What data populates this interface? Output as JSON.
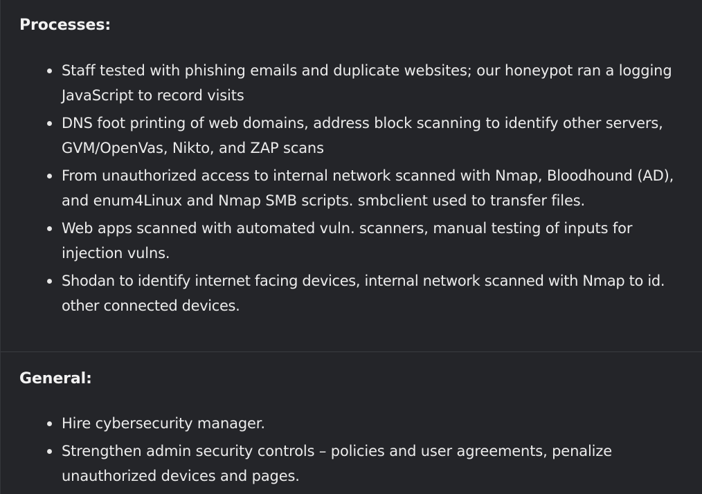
{
  "processes": {
    "heading": "Processes:",
    "items": [
      "Staff tested with phishing emails and duplicate websites; our honeypot ran a logging JavaScript to record visits",
      "DNS foot printing of web domains, address block scanning to identify other servers, GVM/OpenVas, Nikto, and ZAP scans",
      "From unauthorized access to internal network scanned with Nmap, Bloodhound (AD), and enum4Linux and Nmap SMB scripts. smbclient used to transfer files.",
      "Web apps scanned with automated vuln. scanners, manual testing of inputs for injection vulns.",
      "Shodan to identify internet facing devices, internal network scanned with Nmap to id. other connected devices."
    ]
  },
  "general": {
    "heading": "General:",
    "items": [
      "Hire cybersecurity manager.",
      "Strengthen admin security controls – policies and user agreements, penalize unauthorized devices and pages."
    ]
  }
}
